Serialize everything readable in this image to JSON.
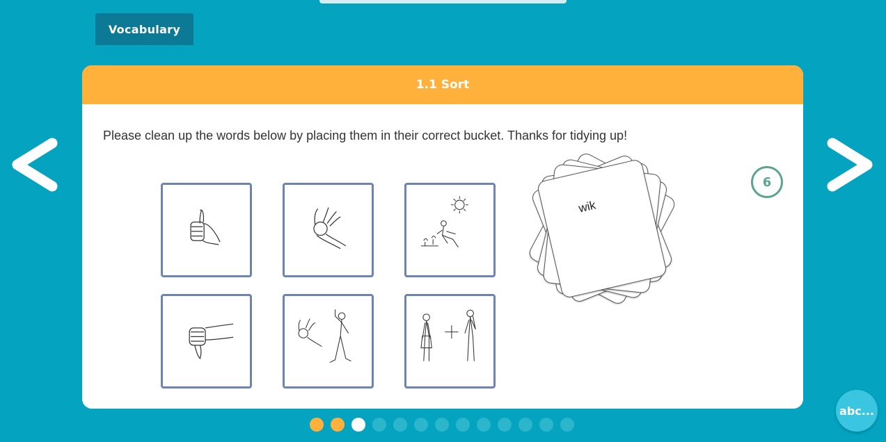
{
  "tab": {
    "label": "Vocabulary"
  },
  "activity": {
    "title": "1.1 Sort",
    "instructions": "Please clean up the words below by placing them in their correct bucket. Thanks for tidying up!",
    "remaining_count": "6",
    "current_word": "wik"
  },
  "buckets": [
    {
      "icon": "thumbs-up-icon"
    },
    {
      "icon": "ok-hand-icon"
    },
    {
      "icon": "woman-sunbathing-icon"
    },
    {
      "icon": "thumbs-down-icon"
    },
    {
      "icon": "ok-hand-man-walking-icon"
    },
    {
      "icon": "woman-plus-man-icon"
    }
  ],
  "pagination": {
    "total": 13,
    "completed": 2,
    "current": 3
  },
  "abc_button": {
    "label": "abc..."
  },
  "colors": {
    "background": "#04a3c0",
    "header": "#ffb13b",
    "tab": "#0c7a96",
    "tile_border": "#6b84b5",
    "badge": "#5aa58f"
  }
}
